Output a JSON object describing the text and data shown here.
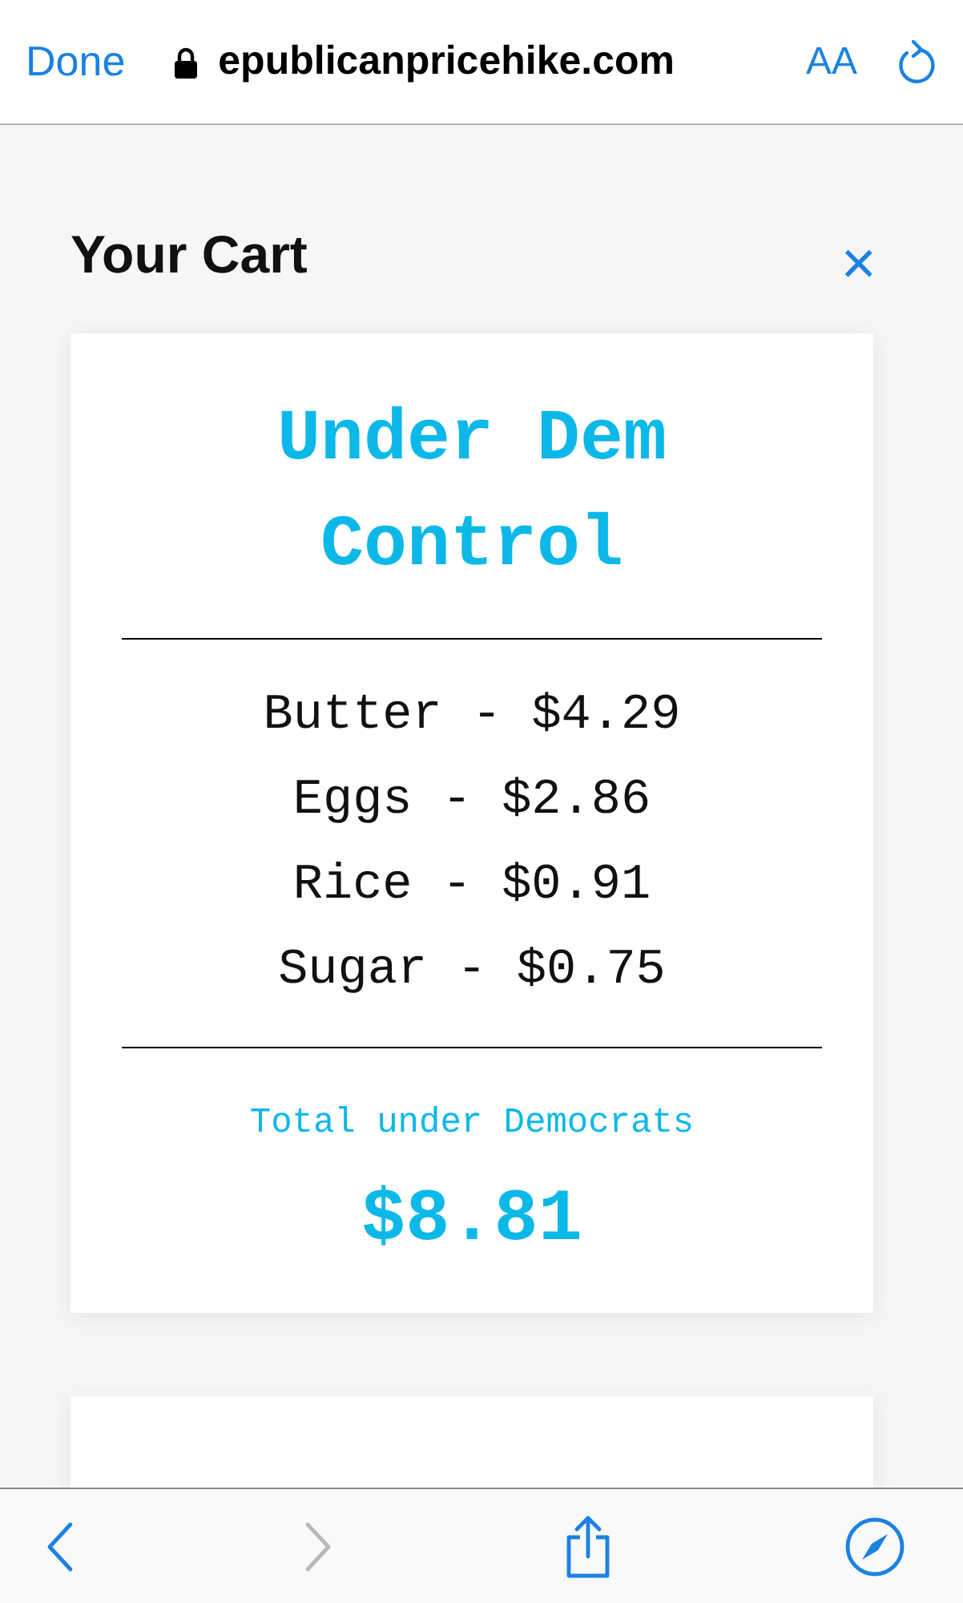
{
  "browser_bar": {
    "done": "Done",
    "url": "epublicanpricehike.com",
    "text_size": "AA"
  },
  "cart": {
    "title": "Your Cart",
    "close": "×"
  },
  "card": {
    "heading": "Under Dem Control",
    "items": [
      "Butter - $4.29",
      "Eggs - $2.86",
      "Rice - $0.91",
      "Sugar - $0.75"
    ],
    "total_label": "Total under Democrats",
    "total": "$8.81"
  },
  "toolbar": {
    "back_disabled": false,
    "forward_disabled": true
  }
}
